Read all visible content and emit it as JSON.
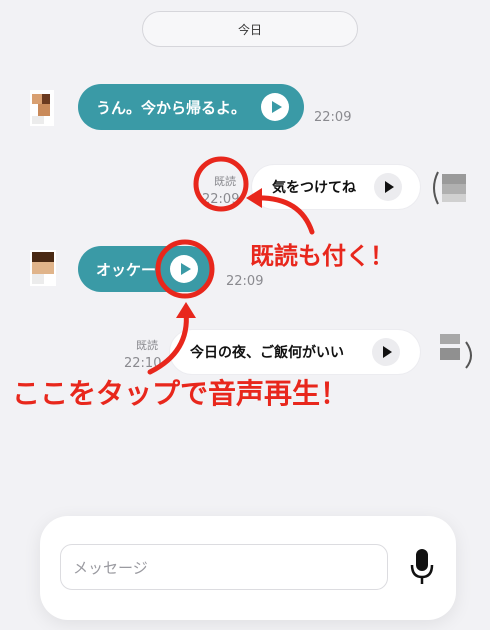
{
  "date_label": "今日",
  "messages": [
    {
      "direction": "incoming",
      "text": "うん。今から帰るよ。",
      "time": "22:09"
    },
    {
      "direction": "outgoing",
      "read": "既読",
      "text": "気をつけてね",
      "time": "22:09"
    },
    {
      "direction": "incoming",
      "text": "オッケー",
      "time": "22:09"
    },
    {
      "direction": "outgoing",
      "read": "既読",
      "text": "今日の夜、ご飯何がいい",
      "time": "22:10"
    }
  ],
  "annotations": {
    "read_note": "既読も付く！",
    "tap_note": "ここをタップで音声再生！"
  },
  "composer": {
    "placeholder": "メッセージ"
  },
  "colors": {
    "incoming_bubble": "#3a9aa6",
    "annotation": "#e8271c",
    "background": "#f2f2f5"
  }
}
